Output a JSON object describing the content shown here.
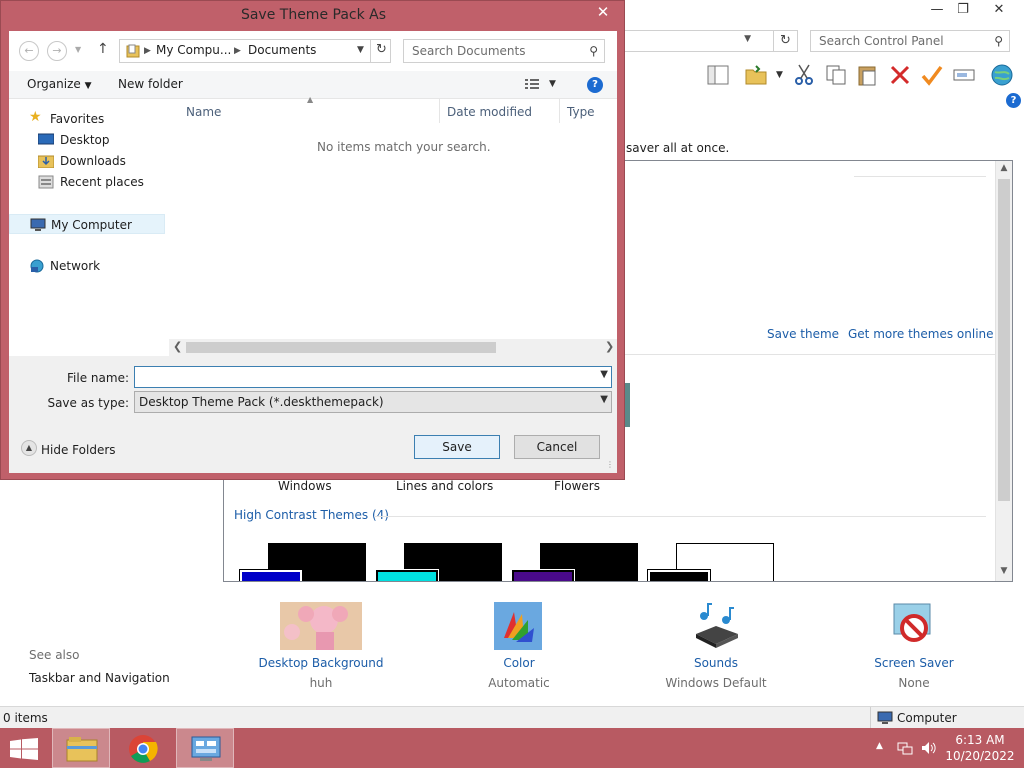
{
  "control_panel": {
    "search_placeholder": "Search Control Panel",
    "description_fragment": "saver all at once.",
    "links": {
      "save_theme": "Save theme",
      "get_more": "Get more themes online"
    },
    "themes": [
      "Windows",
      "Lines and colors",
      "Flowers"
    ],
    "high_contrast_header": "High Contrast Themes (4)",
    "see_also": {
      "title": "See also",
      "item": "Taskbar and Navigation"
    },
    "bottom_items": [
      {
        "label": "Desktop Background",
        "sub": "huh"
      },
      {
        "label": "Color",
        "sub": "Automatic"
      },
      {
        "label": "Sounds",
        "sub": "Windows Default"
      },
      {
        "label": "Screen Saver",
        "sub": "None"
      }
    ],
    "status": {
      "items": "0 items",
      "location": "Computer"
    }
  },
  "dialog": {
    "title": "Save Theme Pack As",
    "breadcrumb": [
      "My Compu...",
      "Documents"
    ],
    "search_placeholder": "Search Documents",
    "toolbar": {
      "organize": "Organize",
      "new_folder": "New folder"
    },
    "nav": {
      "favorites": "Favorites",
      "desktop": "Desktop",
      "downloads": "Downloads",
      "recent": "Recent places",
      "computer": "My Computer",
      "network": "Network"
    },
    "columns": {
      "name": "Name",
      "date": "Date modified",
      "type": "Type"
    },
    "empty_message": "No items match your search.",
    "file_name_label": "File name:",
    "file_name_value": "",
    "save_type_label": "Save as type:",
    "save_type_value": "Desktop Theme Pack (*.deskthemepack)",
    "hide_folders": "Hide Folders",
    "save": "Save",
    "cancel": "Cancel"
  },
  "taskbar": {
    "time": "6:13 AM",
    "date": "10/20/2022"
  },
  "colors": {
    "dialog_frame": "#c0606a",
    "taskbar": "#b85a62",
    "link": "#1c5da8"
  }
}
